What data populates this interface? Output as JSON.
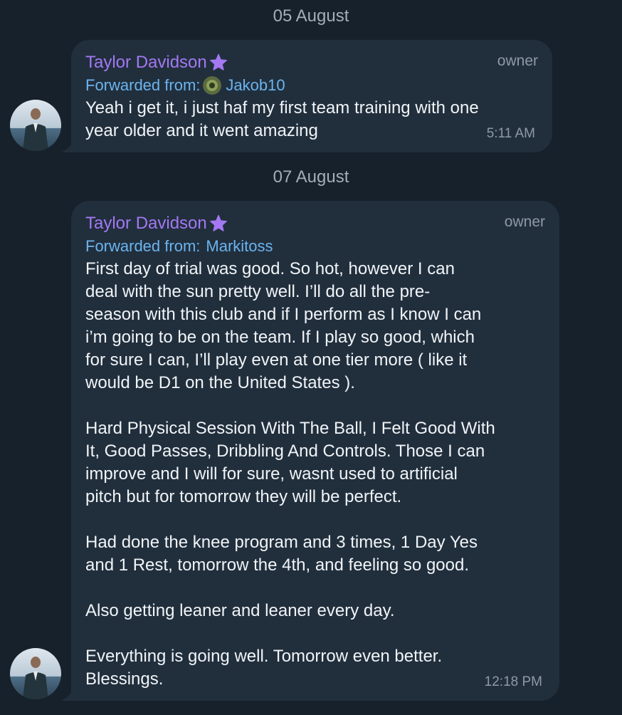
{
  "dates": [
    "05 August",
    "07 August"
  ],
  "messages": [
    {
      "sender": "Taylor Davidson",
      "role": "owner",
      "forwarded_prefix": "Forwarded from:",
      "forwarded_from": "Jakob10",
      "text": "Yeah i get it, i just haf my first team training with one\nyear older and it went amazing",
      "time": "5:11 AM"
    },
    {
      "sender": "Taylor Davidson",
      "role": "owner",
      "forwarded_prefix": "Forwarded from:",
      "forwarded_from": "Markitoss",
      "text": "First day of trial was good. So hot, however I can\ndeal with the sun pretty well. I’ll do all the pre-\nseason with this club and if I perform as I know I can\ni’m going to be on the team. If I play so good, which\nfor sure I can, I’ll play even at one tier more ( like it\nwould be D1 on the United States ).\n\nHard Physical Session With The Ball, I Felt Good With\nIt, Good Passes, Dribbling And Controls. Those I can\nimprove and I will for sure, wasnt used to artificial\npitch but for tomorrow they will be perfect.\n\nHad done the knee program and 3 times, 1 Day Yes\nand 1 Rest, tomorrow the 4th, and feeling so good.\n\nAlso getting leaner and leaner every day.\n\nEverything is going well. Tomorrow even better.\nBlessings.",
      "time": "12:18 PM"
    }
  ],
  "colors": {
    "background": "#17212b",
    "bubble": "#212f3d",
    "sender": "#a378f2",
    "forwarded": "#6bb4ef",
    "meta": "#8e99a5"
  },
  "icons": {
    "badge": "star-icon"
  }
}
